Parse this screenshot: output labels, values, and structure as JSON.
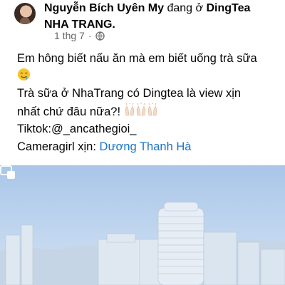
{
  "post": {
    "author": "Nguyễn Bích Uyên My",
    "checkin_verb": "đang ở",
    "place_line1": "DingTea",
    "place_line2": "NHA TRANG.",
    "date": "1 thg 7",
    "separator": "·",
    "privacy_icon": "globe-icon",
    "text_lines": [
      "Em hông biết nấu ăn mà em biết uống trà sữa",
      "Trà sữa ở NhaTrang có Dingtea là view xịn",
      "nhất chứ đâu nữa?!",
      "Tiktok:@_ancathegioi_"
    ],
    "camera_label": "Cameragirl xịn:",
    "camera_tag": "Dương Thanh Hà",
    "emojis": [
      "drooling-face",
      "raising-hands"
    ]
  },
  "media": {
    "type": "video",
    "pip_icon": "picture-in-picture-icon"
  },
  "colors": {
    "meta_gray": "#65676b",
    "link_blue": "#1a73c8",
    "text": "#050505"
  }
}
